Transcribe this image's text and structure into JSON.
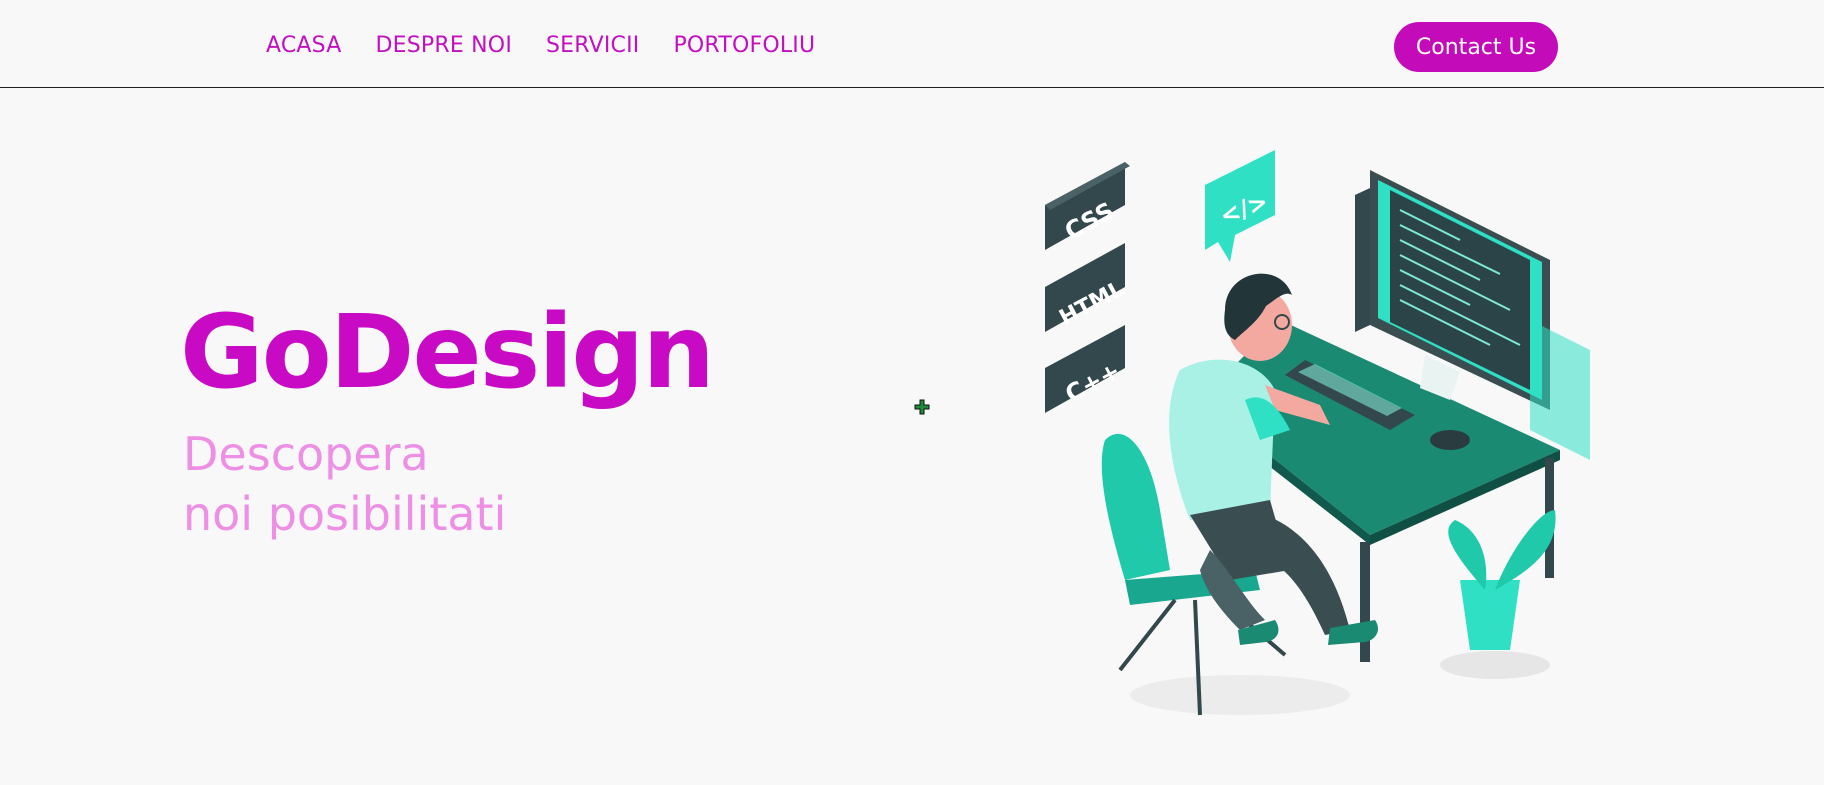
{
  "nav": {
    "items": [
      "ACASA",
      "DESPRE NOI",
      "SERVICII",
      "PORTOFOLIU"
    ],
    "contact_label": "Contact Us"
  },
  "hero": {
    "title": "GoDesign",
    "tagline_line1": "Descopera",
    "tagline_line2": "noi posibilitati"
  },
  "illustration": {
    "labels": [
      "CSS",
      "HTML",
      "C++",
      "</>"
    ]
  },
  "colors": {
    "brand": "#c90ac5",
    "tagline": "#ee8fe6",
    "accent_teal": "#2fe0c4",
    "dark_teal": "#137563"
  }
}
